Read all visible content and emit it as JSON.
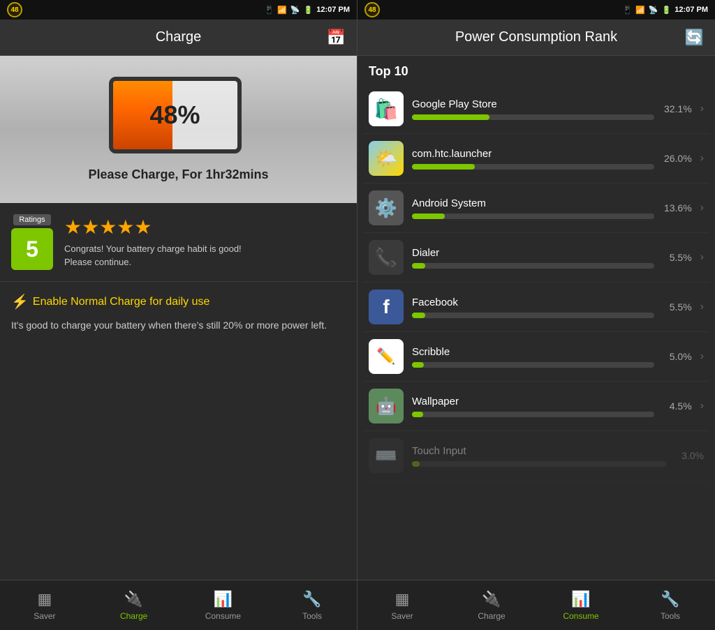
{
  "status": {
    "time": "12:07 PM",
    "battery_number": "48"
  },
  "left_panel": {
    "header": {
      "title": "Charge",
      "icon": "📅"
    },
    "battery": {
      "percentage": "48%",
      "message": "Please Charge, For 1hr32mins",
      "fill_percent": 48
    },
    "ratings": {
      "label": "Ratings",
      "score": "5",
      "stars": "★★★★★",
      "text": "Congrats! Your battery charge habit is good!\nPlease continue."
    },
    "advice": {
      "title": "Enable Normal Charge for daily use",
      "body": "It's good to charge your battery when there's still 20% or more power left."
    },
    "nav": [
      {
        "id": "saver",
        "label": "Saver",
        "icon": "🔋",
        "active": false
      },
      {
        "id": "charge",
        "label": "Charge",
        "icon": "🔌",
        "active": true
      },
      {
        "id": "consume",
        "label": "Consume",
        "icon": "📊",
        "active": false
      },
      {
        "id": "tools",
        "label": "Tools",
        "icon": "🔧",
        "active": false
      }
    ]
  },
  "right_panel": {
    "header": {
      "title": "Power Consumption Rank"
    },
    "section_label": "Top 10",
    "apps": [
      {
        "name": "Google Play Store",
        "percent": "32.1%",
        "bar": 32.1,
        "icon_type": "gplay"
      },
      {
        "name": "com.htc.launcher",
        "percent": "26.0%",
        "bar": 26.0,
        "icon_type": "weather"
      },
      {
        "name": "Android System",
        "percent": "13.6%",
        "bar": 13.6,
        "icon_type": "android"
      },
      {
        "name": "Dialer",
        "percent": "5.5%",
        "bar": 5.5,
        "icon_type": "dialer"
      },
      {
        "name": "Facebook",
        "percent": "5.5%",
        "bar": 5.5,
        "icon_type": "facebook"
      },
      {
        "name": "Scribble",
        "percent": "5.0%",
        "bar": 5.0,
        "icon_type": "scribble"
      },
      {
        "name": "Wallpaper",
        "percent": "4.5%",
        "bar": 4.5,
        "icon_type": "wallpaper"
      }
    ],
    "nav": [
      {
        "id": "saver",
        "label": "Saver",
        "icon": "🔋",
        "active": false
      },
      {
        "id": "charge",
        "label": "Charge",
        "icon": "🔌",
        "active": false
      },
      {
        "id": "consume",
        "label": "Consume",
        "icon": "📊",
        "active": true
      },
      {
        "id": "tools",
        "label": "Tools",
        "icon": "🔧",
        "active": false
      }
    ]
  }
}
